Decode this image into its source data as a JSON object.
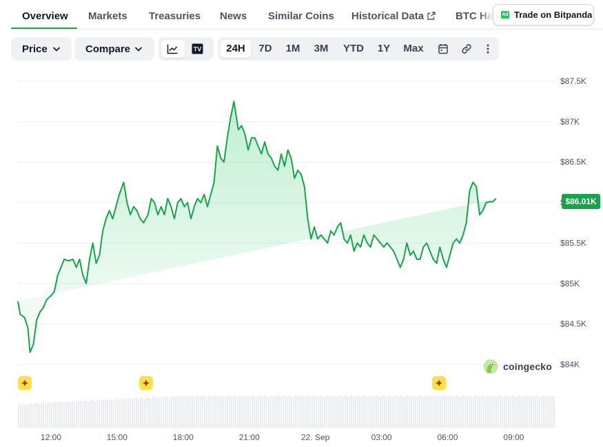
{
  "tabs": [
    {
      "label": "Overview",
      "active": true
    },
    {
      "label": "Markets"
    },
    {
      "label": "Treasuries"
    },
    {
      "label": "News"
    },
    {
      "label": "Similar Coins"
    },
    {
      "label": "Historical Data"
    },
    {
      "label": "BTC Ha"
    }
  ],
  "ad": {
    "badge": "Ad",
    "label": "Trade on Bitpanda"
  },
  "toolbar": {
    "price_label": "Price",
    "compare_label": "Compare",
    "chart_types": [
      "line-chart-icon",
      "tradingview-icon"
    ],
    "ranges": [
      "24H",
      "7D",
      "1M",
      "3M",
      "YTD",
      "1Y",
      "Max"
    ],
    "active_range": "24H",
    "extra_icons": [
      "calendar-icon",
      "link-icon",
      "more-icon"
    ]
  },
  "colors": {
    "accent": "#16a34a",
    "line": "#16a34a",
    "event": "#fde047"
  },
  "chart_data": {
    "type": "area",
    "x_ticks": [
      "12:00",
      "15:00",
      "18:00",
      "21:00",
      "22. Sep",
      "03:00",
      "06:00",
      "09:00"
    ],
    "y_ticks": [
      "$84K",
      "$84.5K",
      "$85K",
      "$85.5K",
      "$86K",
      "$86.5K",
      "$87K",
      "$87.5K"
    ],
    "x_range_hours": [
      10.5,
      34.8
    ],
    "y_range": [
      84000,
      87500
    ],
    "grid": true,
    "current_price_label": "$86.01K",
    "current_price": 86010,
    "series": [
      {
        "x_hours": [
          10.5,
          10.6,
          10.8,
          10.95,
          11.05,
          11.2,
          11.35,
          11.5,
          11.65,
          11.8,
          12.0,
          12.15,
          12.3,
          12.45,
          12.6,
          12.8,
          13.0,
          13.15,
          13.3,
          13.45,
          13.6,
          13.75,
          13.9,
          14.05,
          14.2,
          14.35,
          14.5,
          14.65,
          14.8,
          14.95,
          15.1,
          15.3,
          15.45,
          15.6,
          15.75,
          15.9,
          16.05,
          16.2,
          16.4,
          16.55,
          16.7,
          16.85,
          17.0,
          17.15,
          17.3,
          17.45,
          17.6,
          17.75,
          17.9,
          18.05,
          18.2,
          18.35,
          18.5,
          18.65,
          18.8,
          18.95,
          19.1,
          19.25,
          19.4,
          19.55,
          19.7,
          19.85,
          20.0,
          20.15,
          20.3,
          20.5,
          20.65,
          20.8,
          20.95,
          21.1,
          21.25,
          21.4,
          21.55,
          21.7,
          21.85,
          22.0,
          22.15,
          22.3,
          22.45,
          22.6,
          22.75,
          22.9,
          23.05,
          23.2,
          23.35,
          23.5,
          23.65,
          23.8,
          23.95,
          24.1,
          24.25,
          24.4,
          24.55,
          24.7,
          24.85,
          25.0,
          25.15,
          25.3,
          25.45,
          25.6,
          25.75,
          25.9,
          26.05,
          26.2,
          26.35,
          26.5,
          26.65,
          26.8,
          26.95,
          27.1,
          27.25,
          27.4,
          27.55,
          27.7,
          27.85,
          28.0,
          28.15,
          28.3,
          28.45,
          28.6,
          28.75,
          28.9,
          29.05,
          29.2,
          29.35,
          29.5,
          29.65,
          29.8,
          29.95,
          30.1,
          30.25,
          30.4,
          30.55,
          30.7,
          30.85,
          31.0,
          31.15,
          31.3,
          31.45,
          31.6,
          31.75,
          31.9,
          32.05,
          32.2,
          32.35,
          32.5,
          32.65,
          32.8,
          32.95,
          33.1,
          33.25,
          33.4,
          33.55,
          33.7,
          33.85,
          34.0,
          34.15,
          34.3,
          34.45,
          34.6,
          34.8
        ],
        "y": [
          84780,
          84620,
          84580,
          84450,
          84150,
          84250,
          84550,
          84650,
          84700,
          84800,
          84850,
          84900,
          85100,
          85200,
          85300,
          85280,
          85300,
          85200,
          85300,
          85100,
          85000,
          85300,
          85500,
          85250,
          85350,
          85650,
          85800,
          85900,
          85800,
          85950,
          86100,
          86250,
          86000,
          85850,
          85950,
          85900,
          85800,
          85750,
          85850,
          86050,
          86000,
          85850,
          85950,
          85850,
          86050,
          85950,
          85800,
          86000,
          86050,
          85950,
          86000,
          85800,
          85950,
          86050,
          86000,
          86100,
          85950,
          86100,
          86250,
          86700,
          86550,
          86500,
          86800,
          87050,
          87250,
          86900,
          86950,
          86850,
          86650,
          86800,
          86800,
          86700,
          86600,
          86750,
          86600,
          86550,
          86450,
          86400,
          86600,
          86450,
          86650,
          86550,
          86300,
          86400,
          86350,
          86200,
          85800,
          85550,
          85700,
          85550,
          85600,
          85550,
          85500,
          85650,
          85600,
          85700,
          85750,
          85550,
          85500,
          85600,
          85400,
          85500,
          85450,
          85600,
          85500,
          85450,
          85600,
          85550,
          85500,
          85450,
          85500,
          85450,
          85400,
          85300,
          85200,
          85300,
          85500,
          85350,
          85400,
          85300,
          85300,
          85450,
          85500,
          85400,
          85300,
          85250,
          85450,
          85300,
          85200,
          85350,
          85500,
          85550,
          85500,
          85600,
          85750,
          86150,
          86250,
          86200,
          85850,
          85900,
          86000,
          86010,
          86010,
          86050
        ],
        "comment_note": ""
      }
    ],
    "event_markers_hours": [
      10.8,
      16.4,
      29.6
    ]
  },
  "brand": {
    "name": "coingecko"
  }
}
